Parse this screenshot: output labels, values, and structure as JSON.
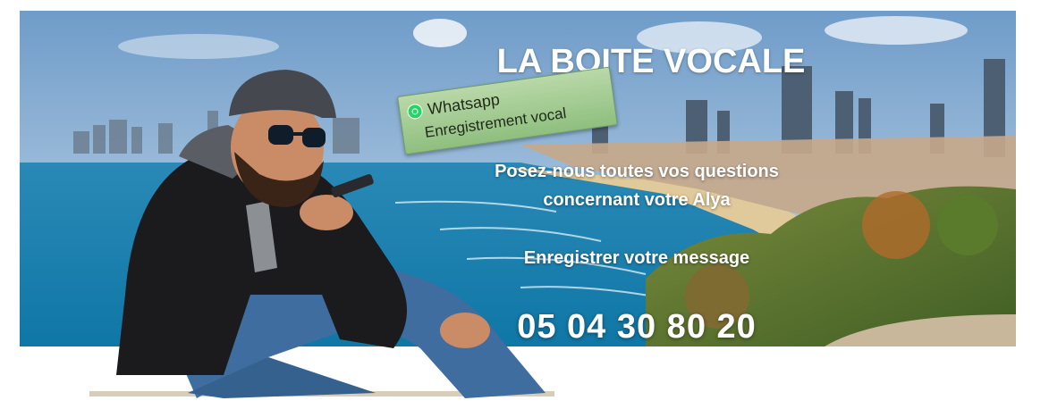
{
  "banner": {
    "title": "LA BOITE VOCALE",
    "subtitle_line1": "Posez-nous toutes vos questions",
    "subtitle_line2": "concernant votre Alya",
    "cta": "Enregistrer votre message",
    "phone": "05 04 30 80 20"
  },
  "whatsapp_tag": {
    "app": "Whatsapp",
    "label": "Enregistrement vocal",
    "icon": "whatsapp-icon"
  },
  "colors": {
    "sky": "#8fb4d8",
    "sea": "#1f8fbf",
    "text": "#ffffff",
    "tag": "#9fcb8c"
  }
}
